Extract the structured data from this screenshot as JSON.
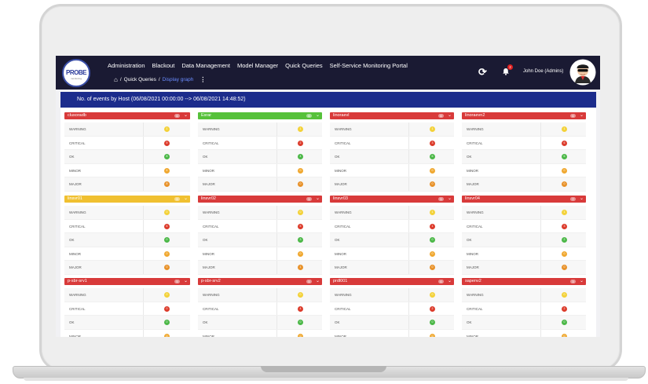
{
  "nav": {
    "logo_text": "PROBE",
    "logo_sub": "monitoring",
    "menu": [
      "Administration",
      "Blackout",
      "Data Management",
      "Model Manager",
      "Quick Queries",
      "Self-Service Monitoring Portal"
    ],
    "breadcrumb": {
      "parent": "Quick Queries",
      "current": "Display graph",
      "separator": "/"
    },
    "notification_count": "2",
    "user_name": "John Doe (Admins)"
  },
  "panel": {
    "title": "No. of events by Host (06/08/2021 00:00:00 --> 06/08/2021 14:48:52)"
  },
  "colors": {
    "critical": "#d83a3a",
    "ok": "#56c13a",
    "warning_header": "#f0c030",
    "dot_warning": "#f3d23a",
    "dot_critical": "#dc3c2c",
    "dot_ok": "#4cb848",
    "dot_minor": "#f0a830",
    "dot_major": "#e8922a",
    "nav_bg": "#1a1a33",
    "panel_head_bg": "#1c2c8c"
  },
  "row_labels": [
    "WARNING",
    "CRITICAL",
    "OK",
    "MINOR",
    "MAJOR"
  ],
  "hosts": [
    {
      "name": "clusoradb",
      "status": "critical",
      "count": "6",
      "values": [
        "1",
        "5",
        "8",
        "4",
        "8"
      ]
    },
    {
      "name": "Esrar",
      "status": "ok",
      "count": "6",
      "values": [
        "1",
        "2",
        "4",
        "0",
        "0"
      ]
    },
    {
      "name": "linoraevl",
      "status": "critical",
      "count": "6",
      "values": [
        "1",
        "3",
        "6",
        "0",
        "0"
      ]
    },
    {
      "name": "linoraevn2",
      "status": "critical",
      "count": "6",
      "values": [
        "1",
        "6",
        "6",
        "0",
        "0"
      ]
    },
    {
      "name": "linsvr01",
      "status": "warning",
      "count": "5",
      "values": [
        "0",
        "6",
        "0",
        "0",
        "0"
      ]
    },
    {
      "name": "linsvr02",
      "status": "critical",
      "count": "5",
      "values": [
        "0",
        "5",
        "3",
        "0",
        "1"
      ]
    },
    {
      "name": "linsvr03",
      "status": "critical",
      "count": "5",
      "values": [
        "1",
        "1",
        "0",
        "0",
        "0"
      ]
    },
    {
      "name": "linsvr04",
      "status": "critical",
      "count": "7",
      "values": [
        "1",
        "3",
        "2",
        "0",
        "0"
      ]
    },
    {
      "name": "p-sbr-srv1",
      "status": "critical",
      "count": "5",
      "values": [
        "0",
        "0",
        "0",
        "0",
        "0"
      ]
    },
    {
      "name": "p-sbr-srv2",
      "status": "critical",
      "count": "5",
      "values": [
        "0",
        "4",
        "0",
        "0",
        "0"
      ]
    },
    {
      "name": "prdl001",
      "status": "critical",
      "count": "6",
      "values": [
        "0",
        "2",
        "0",
        "0",
        "0"
      ]
    },
    {
      "name": "sapenv2",
      "status": "critical",
      "count": "3",
      "values": [
        "0",
        "2",
        "0",
        "0",
        "0"
      ]
    }
  ]
}
